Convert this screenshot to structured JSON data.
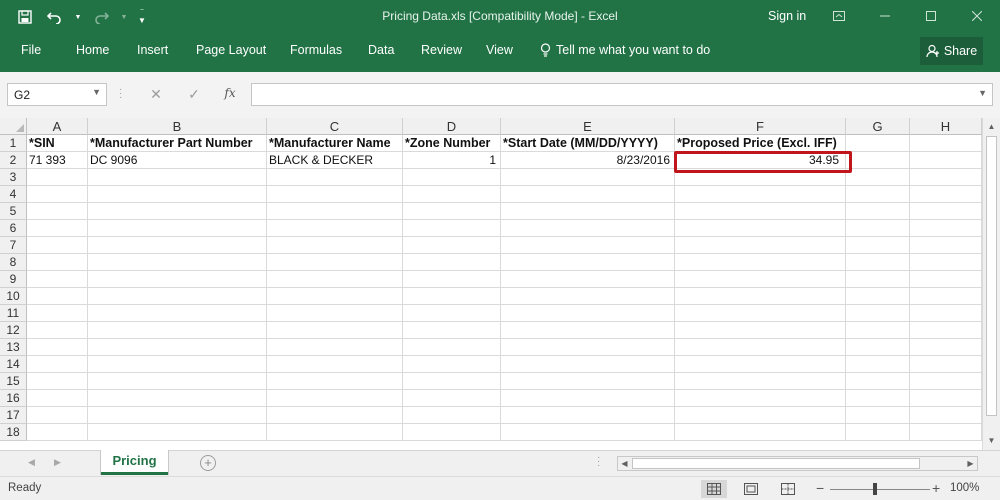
{
  "window": {
    "title": "Pricing Data.xls  [Compatibility Mode] - Excel",
    "sign_in": "Sign in"
  },
  "ribbon": {
    "tabs": [
      "File",
      "Home",
      "Insert",
      "Page Layout",
      "Formulas",
      "Data",
      "Review",
      "View"
    ],
    "tell_me": "Tell me what you want to do",
    "share": "Share"
  },
  "formula_bar": {
    "name_box": "G2",
    "fx_label": "fx",
    "formula": ""
  },
  "grid": {
    "columns": [
      "A",
      "B",
      "C",
      "D",
      "E",
      "F",
      "G",
      "H"
    ],
    "rows": [
      "1",
      "2",
      "3",
      "4",
      "5",
      "6",
      "7",
      "8",
      "9",
      "10",
      "11",
      "12",
      "13",
      "14",
      "15",
      "16",
      "17",
      "18"
    ],
    "header_row": {
      "a": "*SIN",
      "b": "*Manufacturer Part Number",
      "c": "*Manufacturer Name",
      "d": "*Zone Number",
      "e": "*Start Date (MM/DD/YYYY)",
      "f": "*Proposed Price (Excl. IFF)"
    },
    "data_row": {
      "a": "71 393",
      "b": "DC 9096",
      "c": "BLACK & DECKER",
      "d": "1",
      "e": "8/23/2016",
      "f": "34.95"
    }
  },
  "sheets": {
    "active": "Pricing",
    "add_symbol": "+"
  },
  "status_bar": {
    "ready": "Ready",
    "zoom_level": "100%"
  },
  "colors": {
    "brand_green": "#217346",
    "highlight_red": "#c0151b"
  }
}
